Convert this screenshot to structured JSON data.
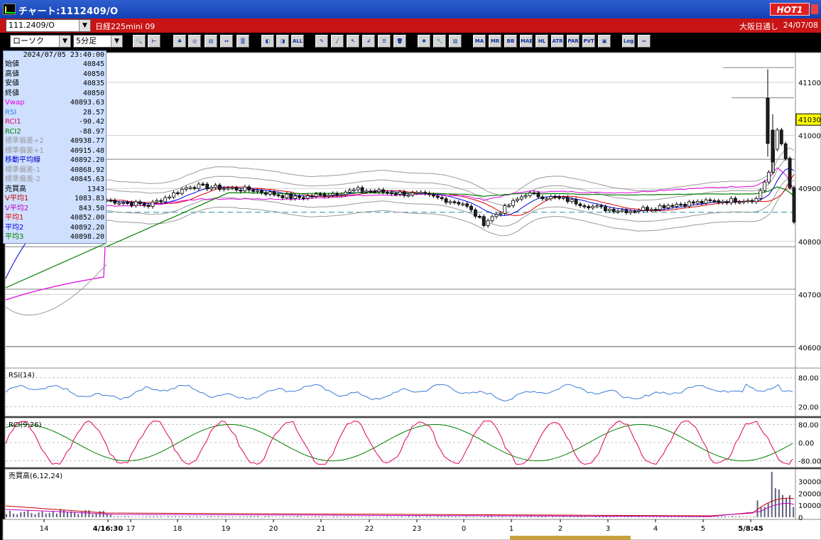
{
  "window": {
    "title": "チャート:1112409/O",
    "hot_label": "HOT1"
  },
  "info": {
    "symbol_select": "111.2409/O",
    "instrument_name": "日経225mini 09",
    "market": "大阪日通し",
    "date": "24/07/08"
  },
  "controls": {
    "chart_type": "ローソク",
    "interval": "5分足"
  },
  "toolbar": {
    "buttons": [
      {
        "name": "search-icon",
        "glyph": "🔍"
      },
      {
        "name": "ruler-icon",
        "glyph": "⊢"
      },
      {
        "name": "candle-icon",
        "glyph": "♣"
      },
      {
        "name": "zoom-icon",
        "glyph": "◎"
      },
      {
        "name": "chart-icon",
        "glyph": "▤"
      },
      {
        "name": "compare-icon",
        "glyph": "↔"
      },
      {
        "name": "disabled-icon",
        "glyph": "▒"
      },
      {
        "name": "bar-prev-icon",
        "glyph": "◧"
      },
      {
        "name": "bar-next-icon",
        "glyph": "◨"
      },
      {
        "name": "all-icon",
        "glyph": "ALL"
      },
      {
        "name": "pen-icon",
        "glyph": "✎"
      },
      {
        "name": "line-draw-icon",
        "glyph": "╱"
      },
      {
        "name": "cursor-icon",
        "glyph": "↖"
      },
      {
        "name": "arrow-icon",
        "glyph": "↲"
      },
      {
        "name": "memo-icon",
        "glyph": "☰"
      },
      {
        "name": "trash-icon",
        "glyph": "🗑"
      },
      {
        "name": "settings-icon",
        "glyph": "✱"
      },
      {
        "name": "wrench-icon",
        "glyph": "🔧"
      },
      {
        "name": "color-icon",
        "glyph": "▨"
      },
      {
        "name": "ma-indicator-icon",
        "glyph": "MA"
      },
      {
        "name": "mr-indicator-icon",
        "glyph": "MR"
      },
      {
        "name": "bb-indicator-icon",
        "glyph": "BB"
      },
      {
        "name": "mae-indicator-icon",
        "glyph": "MAE"
      },
      {
        "name": "hl-indicator-icon",
        "glyph": "HL"
      },
      {
        "name": "atr-indicator-icon",
        "glyph": "ATR"
      },
      {
        "name": "parabolic-indicator-icon",
        "glyph": "PAR"
      },
      {
        "name": "pvt-indicator-icon",
        "glyph": "PVT"
      },
      {
        "name": "window-icon",
        "glyph": "▣"
      },
      {
        "name": "log-icon",
        "glyph": "Log"
      },
      {
        "name": "export-icon",
        "glyph": "⇨"
      }
    ]
  },
  "data_window": {
    "timestamp": "2024/07/05  23:40:00",
    "rows": [
      {
        "label": "始値",
        "value": "40845",
        "color": "#000000"
      },
      {
        "label": "高値",
        "value": "40850",
        "color": "#000000"
      },
      {
        "label": "安値",
        "value": "40835",
        "color": "#000000"
      },
      {
        "label": "終値",
        "value": "40850",
        "color": "#000000"
      },
      {
        "label": "Vwap",
        "value": "40893.63",
        "color": "#e000e0"
      },
      {
        "label": "RSI",
        "value": "28.57",
        "color": "#3c7cd8"
      },
      {
        "label": "RCI1",
        "value": "-90.42",
        "color": "#e00060"
      },
      {
        "label": "RCI2",
        "value": "-88.97",
        "color": "#008000"
      },
      {
        "label": "標準偏差+2",
        "value": "40938.77",
        "color": "#9a9a9a"
      },
      {
        "label": "標準偏差+1",
        "value": "40915.48",
        "color": "#9a9a9a"
      },
      {
        "label": "移動平均線",
        "value": "40892.20",
        "color": "#0000c0"
      },
      {
        "label": "標準偏差-1",
        "value": "40868.92",
        "color": "#9a9a9a"
      },
      {
        "label": "標準偏差-2",
        "value": "40845.63",
        "color": "#9a9a9a"
      },
      {
        "label": "売買高",
        "value": "1343",
        "color": "#000000"
      },
      {
        "label": "V平均1",
        "value": "1083.83",
        "color": "#c00000"
      },
      {
        "label": "V平均2",
        "value": "843.50",
        "color": "#c000c0"
      },
      {
        "label": "平均1",
        "value": "40852.00",
        "color": "#e00000"
      },
      {
        "label": "平均2",
        "value": "40892.20",
        "color": "#0000e0"
      },
      {
        "label": "平均3",
        "value": "40898.20",
        "color": "#008000"
      }
    ]
  },
  "price_panel": {
    "y_ticks": [
      "41100",
      "41000",
      "40900",
      "40800",
      "40700",
      "40600"
    ],
    "current_price": "41030"
  },
  "rsi_panel": {
    "title": "RSI(14)",
    "y_ticks": [
      "80.00",
      "20.00"
    ]
  },
  "rci_panel": {
    "title": "RCI(9,26)",
    "y_ticks": [
      "80.00",
      "0.00",
      "-80.00"
    ]
  },
  "volume_panel": {
    "title": "売買高(6,12,24)",
    "y_ticks": [
      "30000",
      "20000",
      "10000",
      "0"
    ]
  },
  "x_axis": {
    "labels": [
      "14",
      "4/16:30",
      "17",
      "18",
      "19",
      "20",
      "21",
      "22",
      "23",
      "0",
      "1",
      "2",
      "3",
      "4",
      "5",
      "5/8:45"
    ]
  },
  "colors": {
    "price_up": "#ffffff",
    "price_down": "#202020",
    "vwap": "#e000e0",
    "avg1": "#e00000",
    "avg2": "#0000e0",
    "avg3": "#008000",
    "bollinger": "#9a9a9a",
    "rsi": "#3c7cd8",
    "rci1": "#e00060",
    "rci2": "#008000",
    "hot": "#e02020",
    "titlebar": "#1a4cc0",
    "infobar": "#c81414"
  }
}
